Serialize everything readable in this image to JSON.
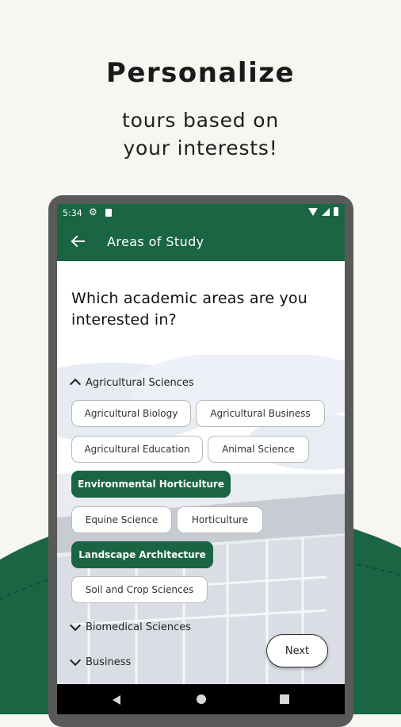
{
  "promo": {
    "title": "Personalize",
    "subtitle_line1": "tours based on",
    "subtitle_line2": "your interests!"
  },
  "status_bar": {
    "time": "5:34"
  },
  "app_bar": {
    "title": "Areas of Study"
  },
  "question": "Which academic areas are you interested in?",
  "sections": [
    {
      "label": "Agricultural Sciences",
      "expanded": true,
      "chips": [
        {
          "label": "Agricultural Biology",
          "selected": false
        },
        {
          "label": "Agricultural Business",
          "selected": false
        },
        {
          "label": "Agricultural Education",
          "selected": false
        },
        {
          "label": "Animal Science",
          "selected": false
        },
        {
          "label": "Environmental Horticulture",
          "selected": true
        },
        {
          "label": "Equine Science",
          "selected": false
        },
        {
          "label": "Horticulture",
          "selected": false
        },
        {
          "label": "Landscape Architecture",
          "selected": true
        },
        {
          "label": "Soil and Crop Sciences",
          "selected": false
        }
      ]
    },
    {
      "label": "Biomedical Sciences",
      "expanded": false
    },
    {
      "label": "Business",
      "expanded": false
    }
  ],
  "next_button": {
    "label": "Next"
  },
  "colors": {
    "brand_green": "#196544",
    "background": "#f7f6f2",
    "device_frame": "#595959"
  }
}
